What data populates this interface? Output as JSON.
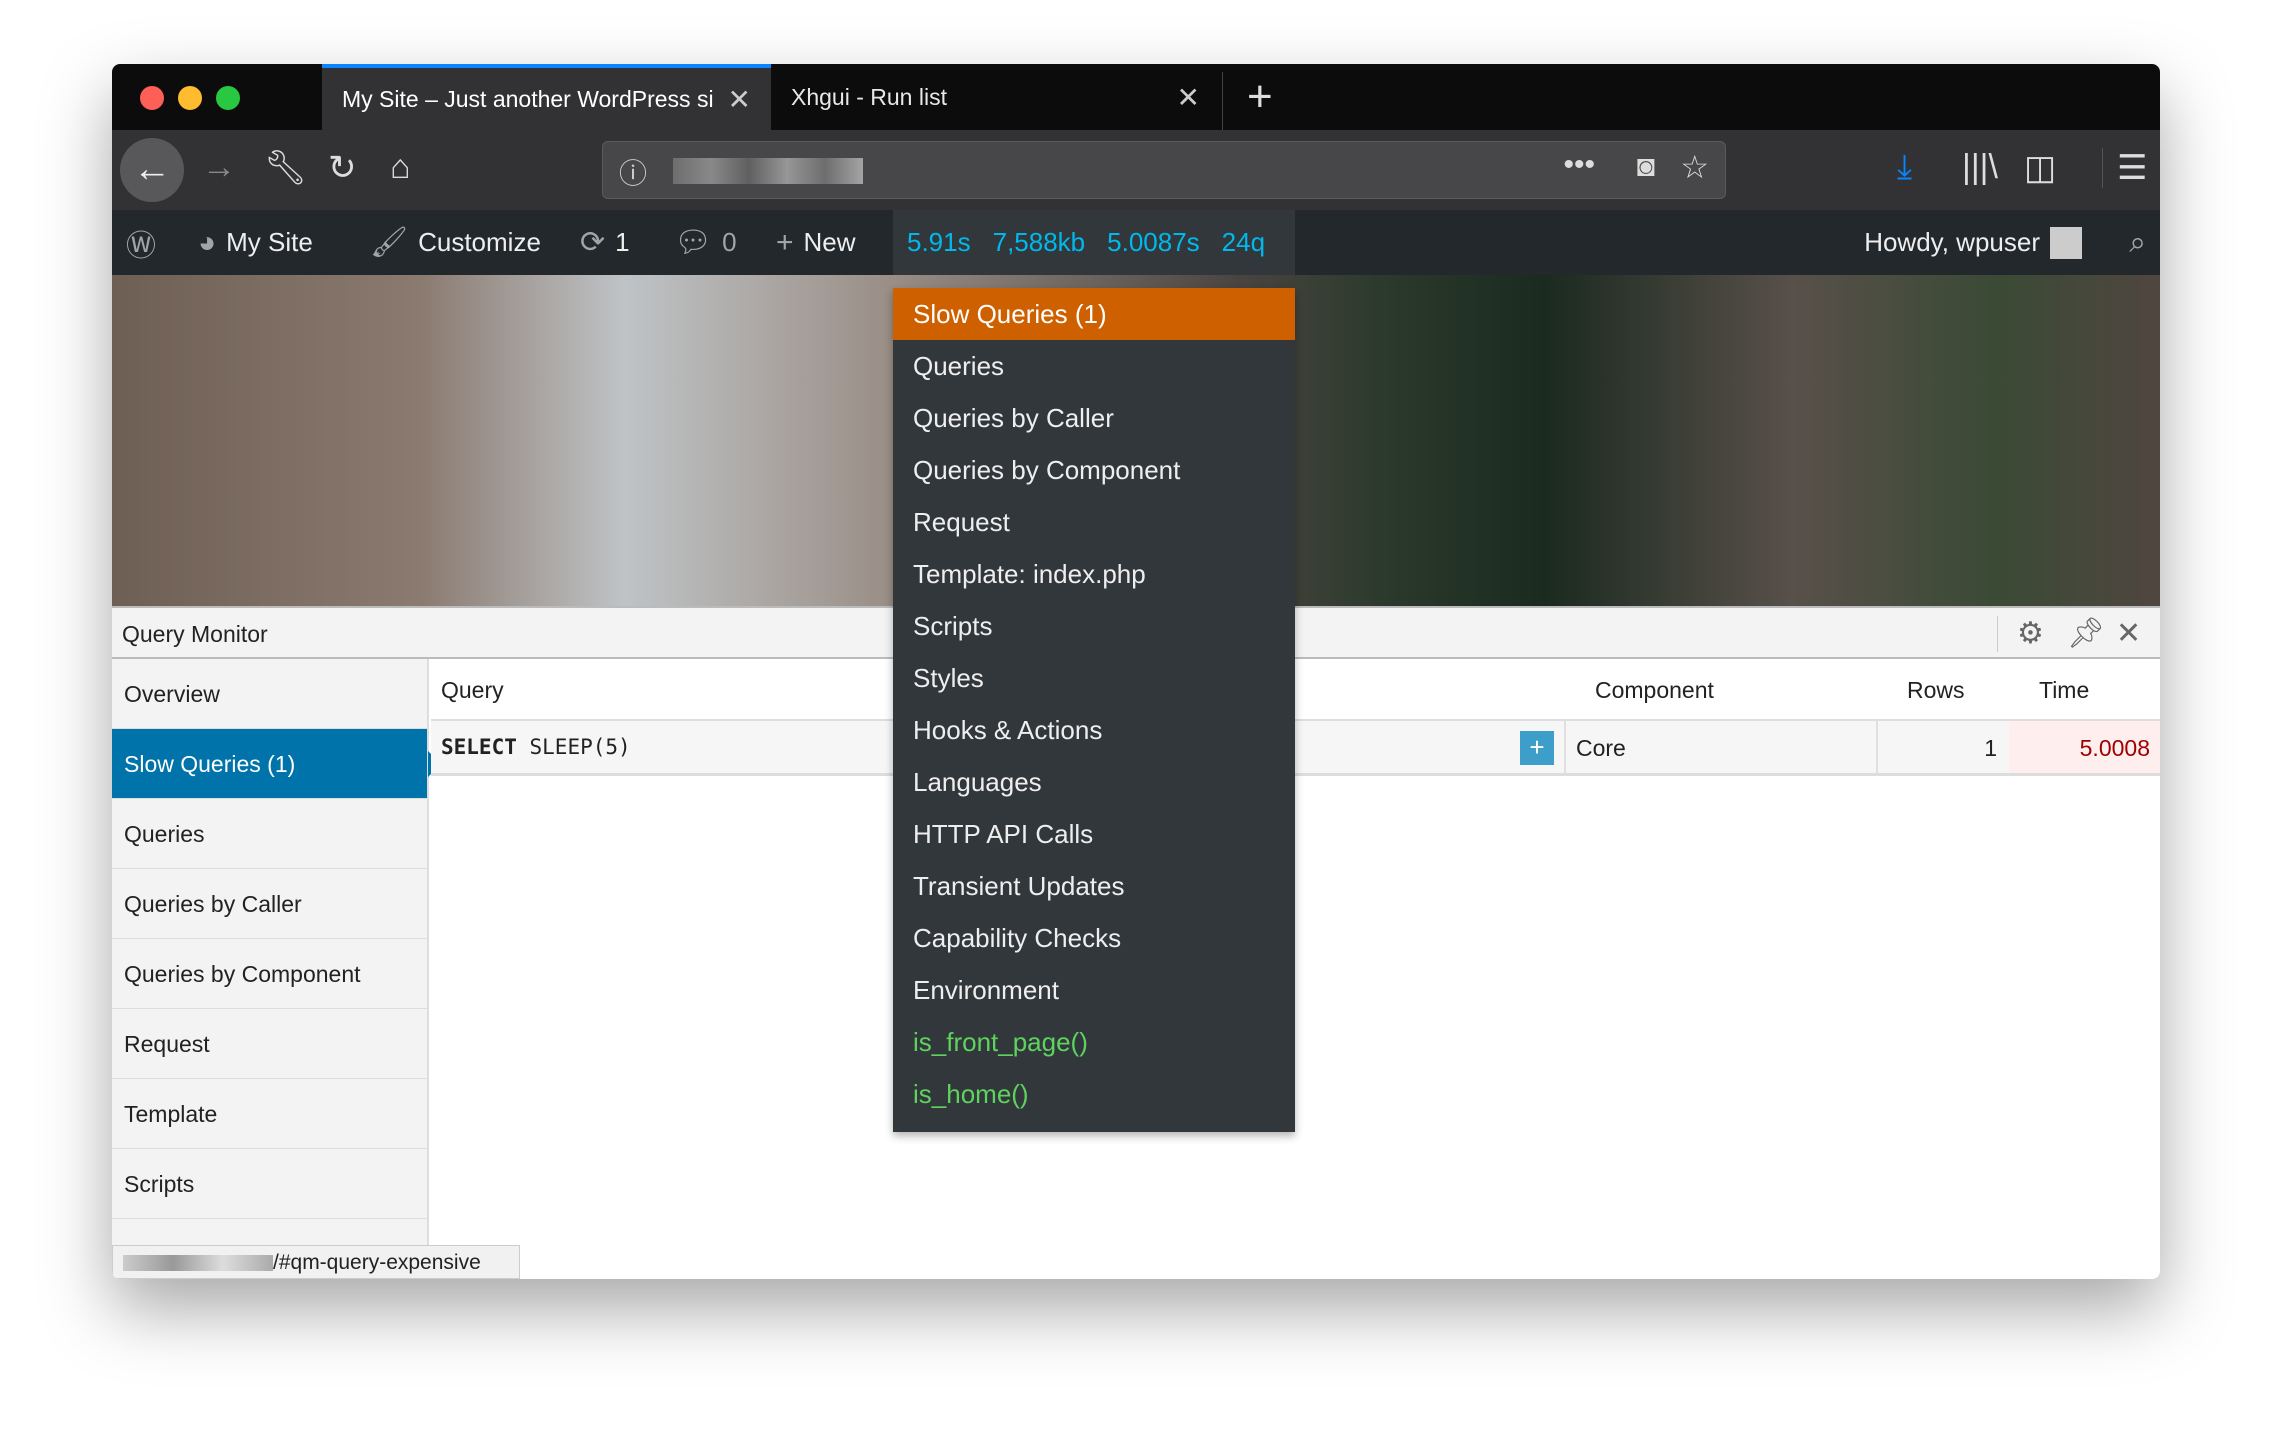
{
  "browser": {
    "tabs": [
      {
        "label": "My Site – Just another WordPress si",
        "active": true
      },
      {
        "label": "Xhgui - Run list",
        "active": false
      }
    ],
    "url_info_icon": "info-icon",
    "icons": [
      "back-icon",
      "forward-icon",
      "wrench-icon",
      "reload-icon",
      "home-icon",
      "more-icon",
      "pocket-icon",
      "star-icon",
      "download-icon",
      "library-icon",
      "sidebar-icon",
      "menu-icon"
    ]
  },
  "adminbar": {
    "my_site": "My Site",
    "customize": "Customize",
    "updates": "1",
    "comments": "0",
    "new": "New",
    "qm": {
      "time": "5.91s",
      "memory": "7,588kb",
      "db_time": "5.0087s",
      "queries": "24q"
    },
    "howdy": "Howdy, wpuser"
  },
  "menu": {
    "items": [
      {
        "label": "Slow Queries (1)",
        "highlight": true
      },
      {
        "label": "Queries"
      },
      {
        "label": "Queries by Caller"
      },
      {
        "label": "Queries by Component"
      },
      {
        "label": "Request"
      },
      {
        "label": "Template: index.php"
      },
      {
        "label": "Scripts"
      },
      {
        "label": "Styles"
      },
      {
        "label": "Hooks & Actions"
      },
      {
        "label": "Languages"
      },
      {
        "label": "HTTP API Calls"
      },
      {
        "label": "Transient Updates"
      },
      {
        "label": "Capability Checks"
      },
      {
        "label": "Environment"
      },
      {
        "label": "is_front_page()",
        "green": true
      },
      {
        "label": "is_home()",
        "green": true
      }
    ]
  },
  "qm": {
    "title": "Query Monitor",
    "sidebar": [
      "Overview",
      "Slow Queries (1)",
      "Queries",
      "Queries by Caller",
      "Queries by Component",
      "Request",
      "Template",
      "Scripts"
    ],
    "table": {
      "headers": [
        "Query",
        "Component",
        "Rows",
        "Time"
      ],
      "rows": [
        {
          "query_kw": "SELECT",
          "query_rest": "SLEEP(5)",
          "component": "Core",
          "rows": "1",
          "time": "5.0008"
        }
      ]
    }
  },
  "status_url": "/#qm-query-expensive",
  "colors": {
    "accent": "#0073aa",
    "highlight": "#cf6000",
    "qm_stat": "#00b9eb",
    "slow_time": "#a00000"
  }
}
